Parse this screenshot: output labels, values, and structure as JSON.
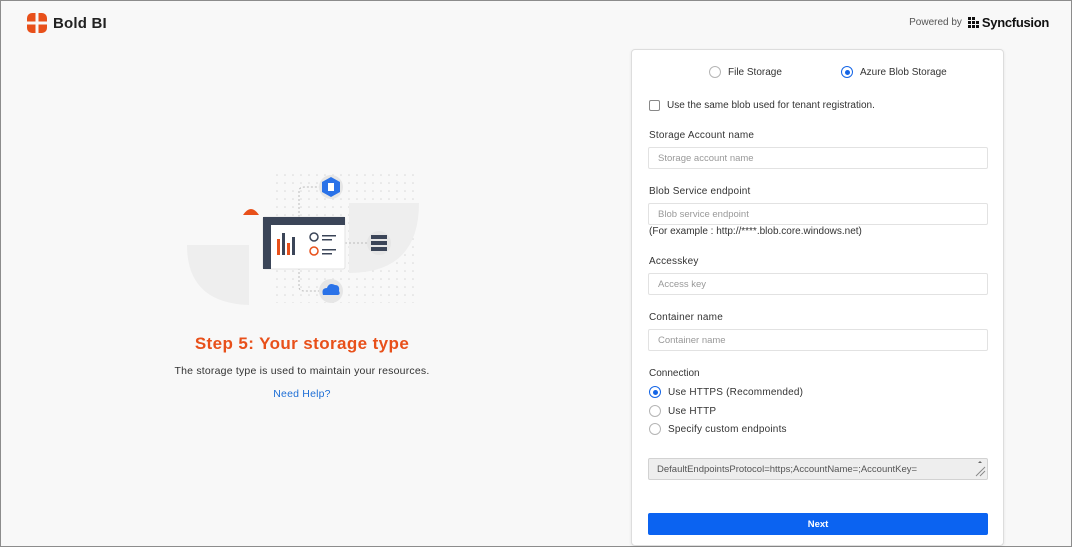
{
  "header": {
    "brand_name": "Bold BI",
    "powered_by_label": "Powered by",
    "powered_by_brand": "Syncfusion"
  },
  "intro": {
    "step_title": "Step 5: Your storage type",
    "description": "The storage type is used to maintain your resources.",
    "help_link": "Need Help?"
  },
  "form": {
    "storage_options": [
      {
        "label": "File Storage",
        "selected": false
      },
      {
        "label": "Azure Blob Storage",
        "selected": true
      }
    ],
    "same_blob_checkbox": {
      "label": "Use the same blob used for tenant registration.",
      "checked": false
    },
    "account_name": {
      "label": "Storage Account name",
      "placeholder": "Storage account name",
      "value": ""
    },
    "blob_endpoint": {
      "label": "Blob Service endpoint",
      "placeholder": "Blob service endpoint",
      "value": "",
      "hint": "(For example : http://****.blob.core.windows.net)"
    },
    "access_key": {
      "label": "Accesskey",
      "placeholder": "Access key",
      "value": ""
    },
    "container": {
      "label": "Container name",
      "placeholder": "Container name",
      "value": ""
    },
    "connection": {
      "label": "Connection",
      "options": [
        {
          "label": "Use HTTPS (Recommended)",
          "selected": true
        },
        {
          "label": "Use HTTP",
          "selected": false
        },
        {
          "label": "Specify custom endpoints",
          "selected": false
        }
      ],
      "connection_string": "DefaultEndpointsProtocol=https;AccountName=;AccountKey="
    },
    "next_button": "Next"
  },
  "colors": {
    "accent_orange": "#e8501a",
    "primary_blue": "#0b63f1",
    "link_blue": "#1f6fd6"
  }
}
